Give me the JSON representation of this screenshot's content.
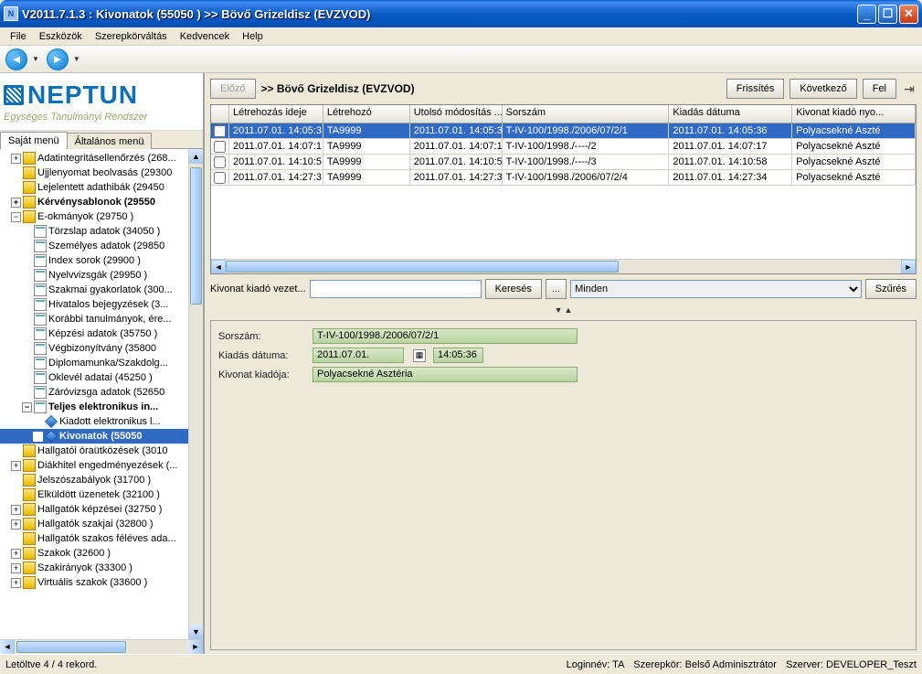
{
  "window": {
    "title": "V2011.7.1.3 : Kivonatok (55050  )   >> Bövő Grizeldisz (EVZVOD)"
  },
  "menubar": [
    "File",
    "Eszközök",
    "Szerepkörváltás",
    "Kedvencek",
    "Help"
  ],
  "logo": {
    "main": "NEPTUN",
    "sub": "Egységes Tanulmányi Rendszer"
  },
  "sidebar_tabs": {
    "active": "Saját menü",
    "inactive": "Általános menü"
  },
  "tree": [
    {
      "indent": 1,
      "exp": "+",
      "icon": "folder-y",
      "bold": false,
      "sel": false,
      "label": "Adatintegritásellenőrzés (268..."
    },
    {
      "indent": 1,
      "exp": "",
      "icon": "folder-y",
      "bold": false,
      "sel": false,
      "label": "Ujjlenyomat beolvasás (29300"
    },
    {
      "indent": 1,
      "exp": "",
      "icon": "folder-y",
      "bold": false,
      "sel": false,
      "label": "Lejelentett adathibák (29450"
    },
    {
      "indent": 1,
      "exp": "+",
      "icon": "folder-y",
      "bold": true,
      "sel": false,
      "label": "Kérvénysablonok (29550"
    },
    {
      "indent": 1,
      "exp": "−",
      "icon": "folder-y",
      "bold": false,
      "sel": false,
      "label": "E-okmányok (29750  )"
    },
    {
      "indent": 2,
      "exp": "",
      "icon": "file-i",
      "bold": false,
      "sel": false,
      "label": "Törzslap adatok (34050  )"
    },
    {
      "indent": 2,
      "exp": "",
      "icon": "file-i",
      "bold": false,
      "sel": false,
      "label": "Személyes adatok (29850"
    },
    {
      "indent": 2,
      "exp": "",
      "icon": "file-i",
      "bold": false,
      "sel": false,
      "label": "Index sorok (29900  )"
    },
    {
      "indent": 2,
      "exp": "",
      "icon": "file-i",
      "bold": false,
      "sel": false,
      "label": "Nyelvvizsgák (29950  )"
    },
    {
      "indent": 2,
      "exp": "",
      "icon": "file-i",
      "bold": false,
      "sel": false,
      "label": "Szakmai gyakorlatok (300..."
    },
    {
      "indent": 2,
      "exp": "",
      "icon": "file-i",
      "bold": false,
      "sel": false,
      "label": "Hivatalos bejegyzések (3..."
    },
    {
      "indent": 2,
      "exp": "",
      "icon": "file-i",
      "bold": false,
      "sel": false,
      "label": "Korábbi tanulmányok, ére..."
    },
    {
      "indent": 2,
      "exp": "",
      "icon": "file-i",
      "bold": false,
      "sel": false,
      "label": "Képzési adatok (35750  )"
    },
    {
      "indent": 2,
      "exp": "",
      "icon": "file-i",
      "bold": false,
      "sel": false,
      "label": "Végbizonyítvány (35800"
    },
    {
      "indent": 2,
      "exp": "",
      "icon": "file-i",
      "bold": false,
      "sel": false,
      "label": "Diplomamunka/Szakdolg..."
    },
    {
      "indent": 2,
      "exp": "",
      "icon": "file-i",
      "bold": false,
      "sel": false,
      "label": "Oklevél adatai (45250  )"
    },
    {
      "indent": 2,
      "exp": "",
      "icon": "file-i",
      "bold": false,
      "sel": false,
      "label": "Záróvizsga adatok (52650"
    },
    {
      "indent": 2,
      "exp": "−",
      "icon": "file-i",
      "bold": true,
      "sel": false,
      "label": "Teljes elektronikus in..."
    },
    {
      "indent": 3,
      "exp": "",
      "icon": "diamond",
      "bold": false,
      "sel": false,
      "label": "Kiadott elektronikus l..."
    },
    {
      "indent": 3,
      "exp": "",
      "icon": "diamond",
      "bold": true,
      "sel": true,
      "label": "Kivonatok (55050"
    },
    {
      "indent": 1,
      "exp": "",
      "icon": "folder-y",
      "bold": false,
      "sel": false,
      "label": "Hallgatói óraütközések (3010"
    },
    {
      "indent": 1,
      "exp": "+",
      "icon": "folder-y",
      "bold": false,
      "sel": false,
      "label": "Diákhitel engedményezések (..."
    },
    {
      "indent": 1,
      "exp": "",
      "icon": "folder-y",
      "bold": false,
      "sel": false,
      "label": "Jelszószabályok (31700  )"
    },
    {
      "indent": 1,
      "exp": "",
      "icon": "folder-y",
      "bold": false,
      "sel": false,
      "label": "Elküldött üzenetek (32100  )"
    },
    {
      "indent": 1,
      "exp": "+",
      "icon": "folder-y",
      "bold": false,
      "sel": false,
      "label": "Hallgatók képzései (32750  )"
    },
    {
      "indent": 1,
      "exp": "+",
      "icon": "folder-y",
      "bold": false,
      "sel": false,
      "label": "Hallgatók szakjai (32800  )"
    },
    {
      "indent": 1,
      "exp": "",
      "icon": "folder-y",
      "bold": false,
      "sel": false,
      "label": "Hallgatók szakos féléves ada..."
    },
    {
      "indent": 1,
      "exp": "+",
      "icon": "folder-y",
      "bold": false,
      "sel": false,
      "label": "Szakok (32600  )"
    },
    {
      "indent": 1,
      "exp": "+",
      "icon": "folder-y",
      "bold": false,
      "sel": false,
      "label": "Szakirányok (33300  )"
    },
    {
      "indent": 1,
      "exp": "+",
      "icon": "folder-y",
      "bold": false,
      "sel": false,
      "label": "Virtuális szakok (33600  )"
    }
  ],
  "header": {
    "prev": "Előző",
    "breadcrumb": ">> Bövő Grizeldisz (EVZVOD)",
    "refresh": "Frissítés",
    "next": "Következő",
    "up": "Fel"
  },
  "grid": {
    "columns": [
      "",
      "Létrehozás ideje",
      "Létrehozó",
      "Utolsó módosítás ...",
      "Sorszám",
      "Kiadás dátuma",
      "Kivonat kiadó nyo..."
    ],
    "rows": [
      {
        "sel": true,
        "c": [
          "2011.07.01. 14:05:3",
          "TA9999",
          "2011.07.01. 14:05:3",
          "T-IV-100/1998./2006/07/2/1",
          "2011.07.01. 14:05:36",
          "Polyacsekné Aszté"
        ]
      },
      {
        "sel": false,
        "c": [
          "2011.07.01. 14:07:1",
          "TA9999",
          "2011.07.01. 14:07:1",
          "T-IV-100/1998./----/2",
          "2011.07.01. 14:07:17",
          "Polyacsekné Aszté"
        ]
      },
      {
        "sel": false,
        "c": [
          "2011.07.01. 14:10:5",
          "TA9999",
          "2011.07.01. 14:10:5",
          "T-IV-100/1998./----/3",
          "2011.07.01. 14:10:58",
          "Polyacsekné Aszté"
        ]
      },
      {
        "sel": false,
        "c": [
          "2011.07.01. 14:27:3",
          "TA9999",
          "2011.07.01. 14:27:3",
          "T-IV-100/1998./2006/07/2/4",
          "2011.07.01. 14:27:34",
          "Polyacsekné Aszté"
        ]
      }
    ]
  },
  "filter": {
    "label": "Kivonat kiadó vezet...",
    "search": "Keresés",
    "dots": "...",
    "select": "Minden",
    "szures": "Szűrés"
  },
  "detail": {
    "l1": "Sorszám:",
    "v1": "T-IV-100/1998./2006/07/2/1",
    "l2": "Kiadás dátuma:",
    "v2a": "2011.07.01.",
    "v2b": "14:05:36",
    "l3": "Kivonat kiadója:",
    "v3": "Polyacsekné Asztéria"
  },
  "status": {
    "left": "Letöltve 4 / 4 rekord.",
    "login": "Loginnév: TA",
    "role": "Szerepkör: Belső Adminisztrátor",
    "server": "Szerver: DEVELOPER_Teszt"
  }
}
